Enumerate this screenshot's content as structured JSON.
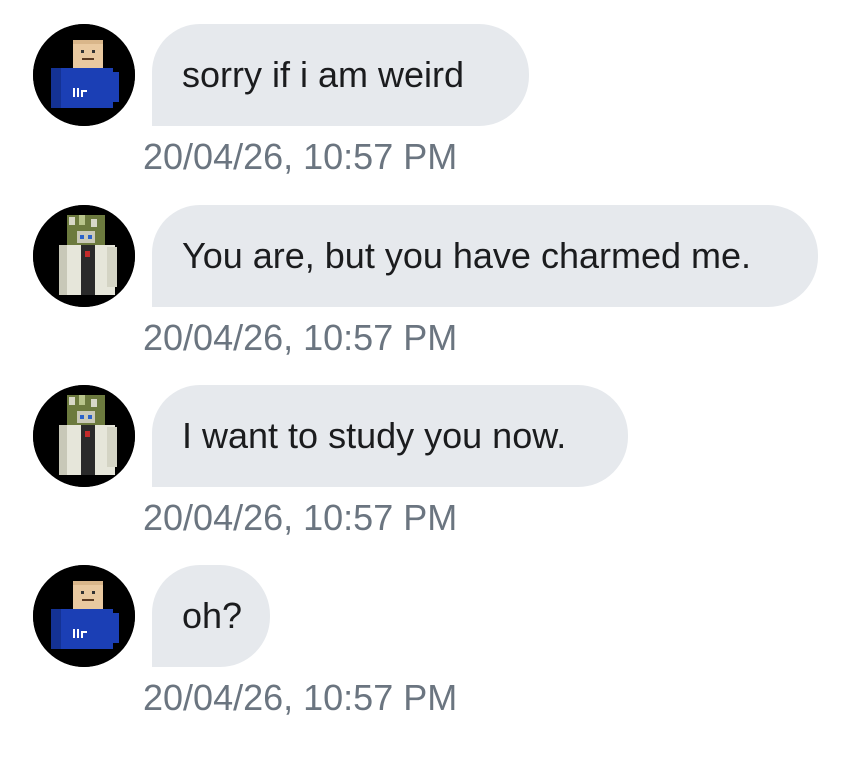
{
  "messages": [
    {
      "avatar_icon": "blocky-character-blue-shirt-avatar-icon",
      "text": "sorry if i am weird",
      "timestamp": "20/04/26, 10:57 PM"
    },
    {
      "avatar_icon": "blocky-character-labcoat-avatar-icon",
      "text": "You are, but you have charmed me.",
      "timestamp": "20/04/26, 10:57 PM"
    },
    {
      "avatar_icon": "blocky-character-labcoat-avatar-icon",
      "text": "I want to study you now.",
      "timestamp": "20/04/26, 10:57 PM"
    },
    {
      "avatar_icon": "blocky-character-blue-shirt-avatar-icon",
      "text": "oh?",
      "timestamp": "20/04/26, 10:57 PM"
    }
  ],
  "colors": {
    "bubble": "#e6e9ed",
    "text": "#1b1c1e",
    "timestamp": "#6b7580",
    "avatar_bg": "#000000"
  }
}
